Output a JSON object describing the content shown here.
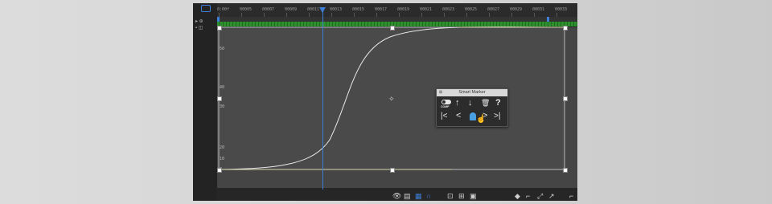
{
  "timeline": {
    "ruler_labels": [
      "0:00f",
      "00005",
      "00007",
      "00009",
      "00011",
      "00013",
      "00015",
      "00017",
      "00019",
      "00021",
      "00023",
      "00025",
      "00027",
      "00029",
      "00031",
      "00033"
    ],
    "y_axis_labels": [
      "50",
      "40",
      "30",
      "20",
      "10",
      "0"
    ],
    "track_color": "#2e8f2e",
    "cti_color": "#3d7fd6"
  },
  "smart_marker_panel": {
    "title": "Smart Marker",
    "toggle_label": "COMP",
    "up_icon": "↑",
    "down_icon": "↓",
    "trash_icon": "🗑",
    "help_icon": "?",
    "first_icon": "|<",
    "prev_icon": "<",
    "next_icon": ">",
    "last_icon": ">|",
    "marker_color": "#4a9fe0"
  },
  "bottom_toolbar": {
    "icons": [
      "eye-icon",
      "graph-type-icon",
      "grid-snap-icon",
      "magnet-icon",
      "fit-selection-icon",
      "fit-all-icon",
      "separate-dimensions-icon",
      "edit-keyframe-icon",
      "hold-icon",
      "easy-ease-icon",
      "ease-in-icon",
      "ease-out-icon"
    ]
  }
}
